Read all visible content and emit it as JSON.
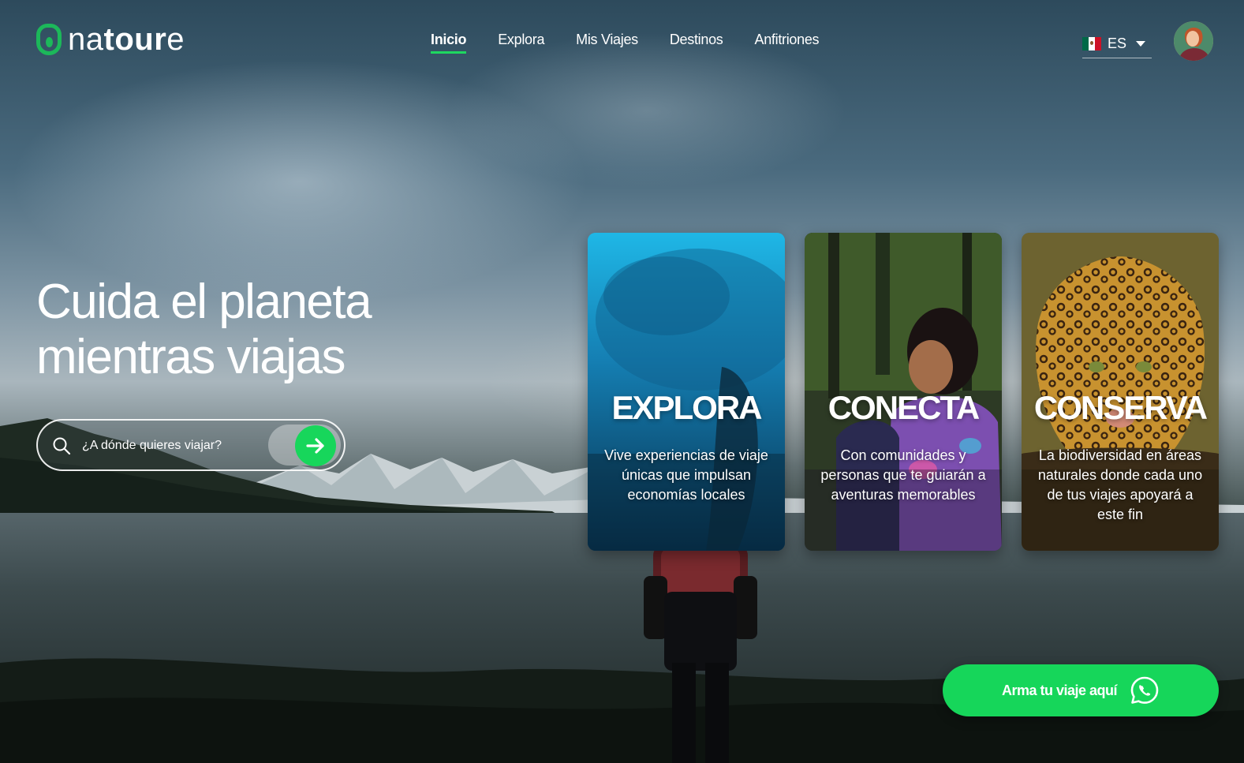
{
  "brand": {
    "name_part1": "na",
    "name_part2": "tour",
    "name_part3": "e",
    "accent": "#1ed760"
  },
  "nav": {
    "items": [
      {
        "label": "Inicio",
        "active": true
      },
      {
        "label": "Explora",
        "active": false
      },
      {
        "label": "Mis Viajes",
        "active": false
      },
      {
        "label": "Destinos",
        "active": false
      },
      {
        "label": "Anfitriones",
        "active": false
      }
    ]
  },
  "language": {
    "code": "ES",
    "flag": "mexico-flag-icon"
  },
  "hero": {
    "headline_line1": "Cuida el planeta",
    "headline_line2": "mientras viajas"
  },
  "search": {
    "placeholder": "¿A dónde quieres viajar?"
  },
  "cards": [
    {
      "title": "EXPLORA",
      "description": "Vive experiencias de viaje únicas que impulsan economías locales"
    },
    {
      "title": "CONECTA",
      "description": "Con comunidades y personas que te guiarán a aventuras memorables"
    },
    {
      "title": "CONSERVA",
      "description": "La biodiversidad en áreas naturales donde cada uno de tus viajes apoyará a este fin"
    }
  ],
  "cta": {
    "label": "Arma tu viaje aquí",
    "icon": "whatsapp-icon",
    "color": "#16d65a"
  }
}
